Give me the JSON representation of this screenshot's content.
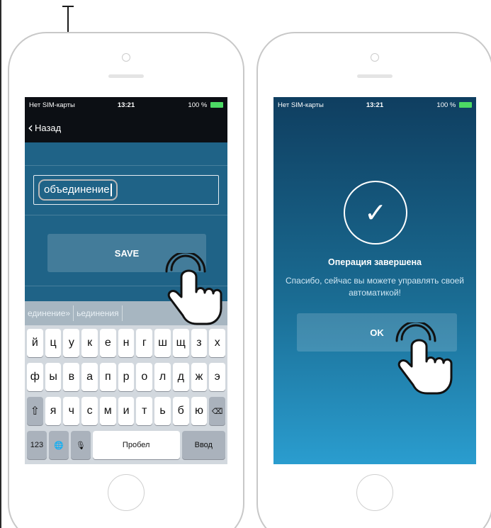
{
  "phone_left": {
    "status": {
      "carrier": "Нет SIM-карты",
      "time": "13:21",
      "battery": "100 %"
    },
    "nav": {
      "back_label": "Назад"
    },
    "field": {
      "value": "объединение"
    },
    "save_label": "SAVE",
    "suggestions": [
      "единение»",
      "ьединения"
    ],
    "keyboard": {
      "row1": [
        "й",
        "ц",
        "у",
        "к",
        "е",
        "н",
        "г",
        "ш",
        "щ",
        "з",
        "х"
      ],
      "row2": [
        "ф",
        "ы",
        "в",
        "а",
        "п",
        "р",
        "о",
        "л",
        "д",
        "ж",
        "э"
      ],
      "row3": [
        "я",
        "ч",
        "с",
        "м",
        "и",
        "т",
        "ь",
        "б",
        "ю"
      ],
      "numbers_label": "123",
      "space_label": "Пробел",
      "return_label": "Ввод"
    }
  },
  "phone_right": {
    "status": {
      "carrier": "Нет SIM-карты",
      "time": "13:21",
      "battery": "100 %"
    },
    "title": "Операция завершена",
    "message": "Спасибо, сейчас вы можете управлять своей автоматикой!",
    "ok_label": "OK"
  },
  "icons": {
    "shift": "⇧",
    "delete": "⌫",
    "globe": "🌐",
    "mic": "🎙",
    "back_chevron": "‹",
    "check": "✓"
  },
  "colors": {
    "screen_blue": "#1f6387",
    "keyboard_gray": "#d2d8de",
    "battery_green": "#4cd964"
  }
}
